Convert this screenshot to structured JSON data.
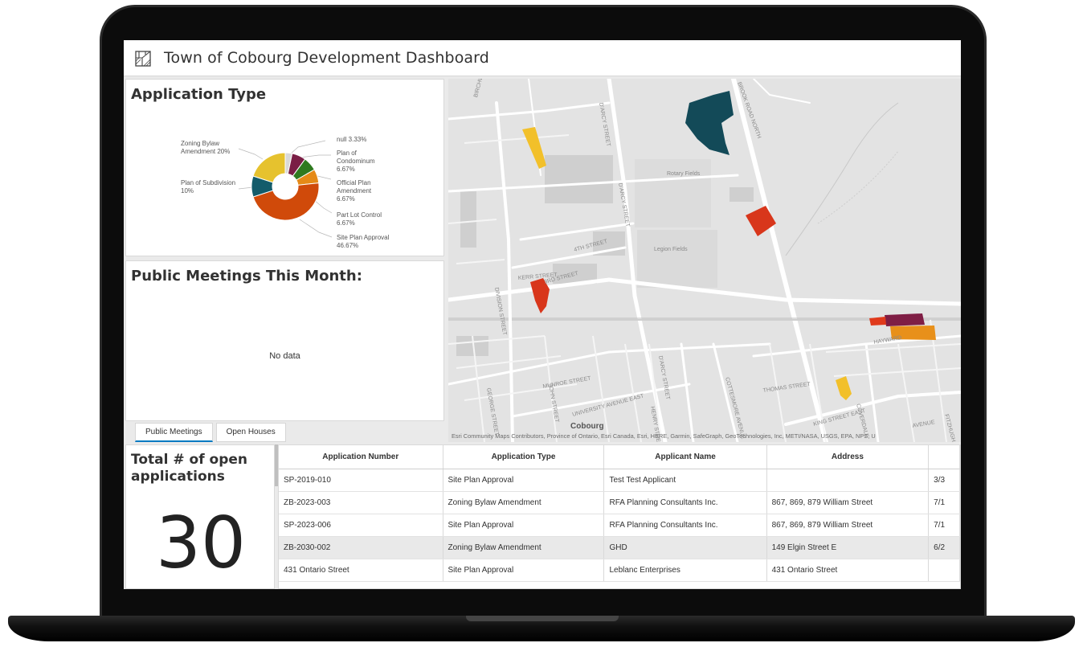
{
  "app": {
    "title": "Town of Cobourg Development Dashboard",
    "logo_icon": "building-plan-icon"
  },
  "pie_panel": {
    "title": "Application Type",
    "labels": {
      "zoning": "Zoning Bylaw Amendment 20%",
      "subdivision": "Plan of Subdivision 10%",
      "null": "null 3.33%",
      "condo": "Plan of Condominum 6.67%",
      "official": "Official Plan Amendment 6.67%",
      "partlot": "Part Lot Control 6.67%",
      "siteplan": "Site Plan Approval 46.67%"
    }
  },
  "chart_data": {
    "type": "pie",
    "title": "Application Type",
    "slices": [
      {
        "name": "null",
        "value": 3.33,
        "color": "#d9d9d9"
      },
      {
        "name": "Plan of Condominum",
        "value": 6.67,
        "color": "#7a1e45"
      },
      {
        "name": "Official Plan Amendment",
        "value": 6.67,
        "color": "#2f7a1f"
      },
      {
        "name": "Part Lot Control",
        "value": 6.67,
        "color": "#e58a17"
      },
      {
        "name": "Site Plan Approval",
        "value": 46.67,
        "color": "#d04a0a"
      },
      {
        "name": "Plan of Subdivision",
        "value": 10,
        "color": "#135c6b"
      },
      {
        "name": "Zoning Bylaw Amendment",
        "value": 20,
        "color": "#e6c22e"
      }
    ]
  },
  "meetings_panel": {
    "title": "Public Meetings This Month:",
    "empty_text": "No data"
  },
  "tabs": [
    "Public Meetings",
    "Open Houses"
  ],
  "map": {
    "attribution": "Esri Community Maps Contributors, Province of Ontario, Esri Canada, Esri, HERE, Garmin, SafeGraph, GeoTechnologies, Inc, METI/NASA, USGS, EPA, NPS, U",
    "labels": {
      "cobourg": "Cobourg",
      "rotary": "Rotary Fields",
      "legion": "Legion Fields",
      "d_arcy": "D'ARCY STREET",
      "fourth": "4TH STREET",
      "third": "3RD STREET",
      "kerr": "KERR STREET",
      "division": "DIVISION STREET",
      "munroe": "MUNROE STREET",
      "university": "UNIVERSITY AVENUE EAST",
      "thomas": "THOMAS STREET",
      "king": "KING STREET EAST",
      "brook": "BROOK ROAD NORTH",
      "birchwood": "BIRCHWOOD",
      "george": "GEORGE STREET",
      "john": "JOHN STREET",
      "henry": "HENRY STREET",
      "cottesmore": "COTTESMORE AVENUE",
      "coverdale": "COVERDALE",
      "hayward": "HAYWARD",
      "fitzhugh": "FITZHUGH",
      "avenue": "AVENUE"
    }
  },
  "total": {
    "title": "Total # of open applications",
    "value": "30"
  },
  "table": {
    "headers": [
      "Application Number",
      "Application Type",
      "Applicant Name",
      "Address",
      ""
    ],
    "rows": [
      [
        "SP-2019-010",
        "Site Plan Approval",
        "Test Test Applicant",
        "",
        "3/3"
      ],
      [
        "ZB-2023-003",
        "Zoning Bylaw Amendment",
        "RFA Planning Consultants Inc.",
        "867, 869, 879 William Street",
        "7/1"
      ],
      [
        "SP-2023-006",
        "Site Plan Approval",
        "RFA Planning Consultants Inc.",
        "867, 869, 879 William Street",
        "7/1"
      ],
      [
        "ZB-2030-002",
        "Zoning Bylaw Amendment",
        "GHD",
        "149 Elgin Street E",
        "6/2"
      ],
      [
        "431 Ontario Street",
        "Site Plan Approval",
        "Leblanc Enterprises",
        "431 Ontario Street",
        ""
      ]
    ]
  }
}
